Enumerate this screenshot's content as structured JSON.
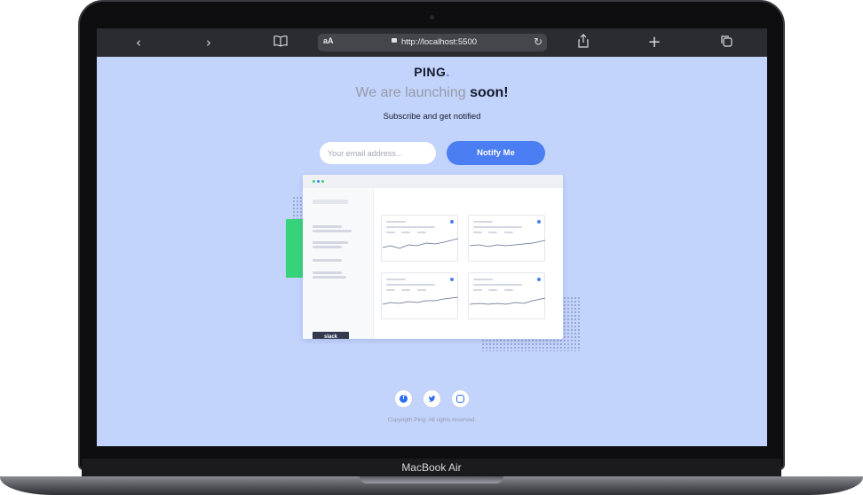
{
  "device": {
    "label": "MacBook Air"
  },
  "browser": {
    "back_icon": "chevron-left",
    "forward_icon": "chevron-right",
    "reader_label": "aA",
    "url": "http://localhost:5500",
    "bookmarks_icon": "book",
    "share_icon": "share",
    "new_tab_icon": "plus",
    "tabs_icon": "tabs"
  },
  "page": {
    "logo": "PING",
    "logo_dot": ".",
    "headline_light": "We are launching ",
    "headline_bold": "soon!",
    "subtitle": "Subscribe and get notified",
    "email_placeholder": "Your email address...",
    "notify_button": "Notify Me",
    "mockup_badge": "slack",
    "social": [
      {
        "name": "facebook",
        "glyph": "f"
      },
      {
        "name": "twitter",
        "glyph": "t"
      },
      {
        "name": "instagram",
        "glyph": ""
      }
    ],
    "copyright": "Copyrigth Ping. All rights reserved."
  },
  "colors": {
    "background": "#c2d3fc",
    "accent": "#4c7ef3",
    "dark_text": "#15192b",
    "muted_text": "#969aa8",
    "green": "#36d37a"
  }
}
